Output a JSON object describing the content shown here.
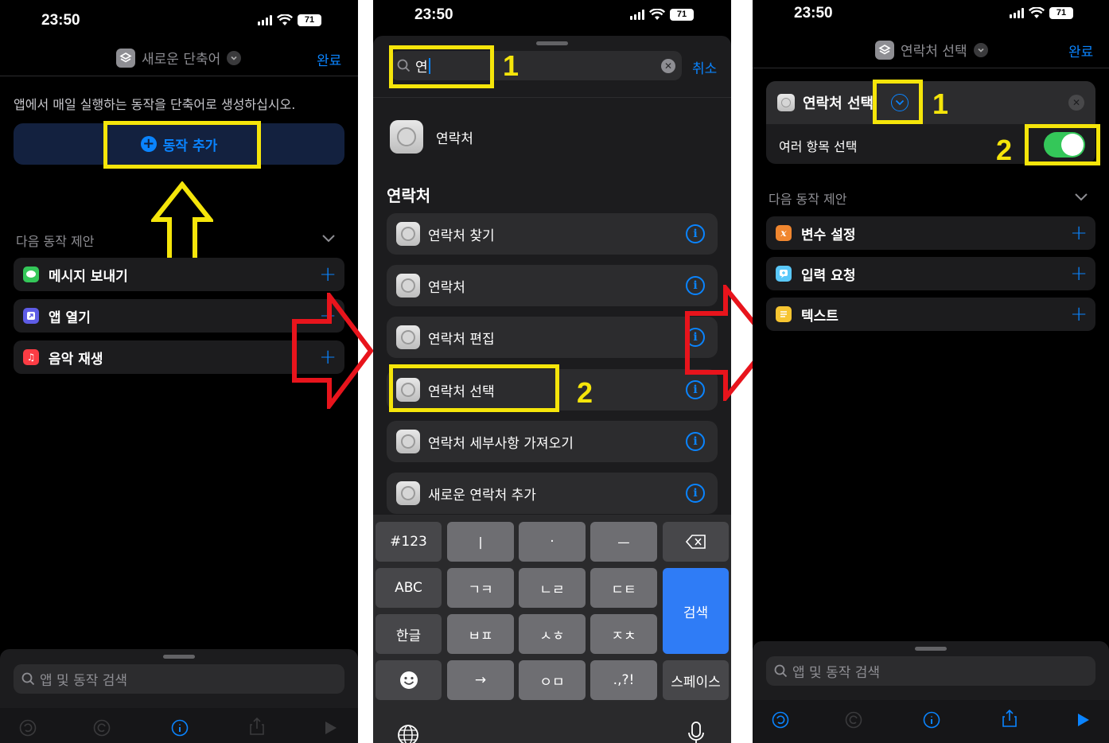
{
  "panel1": {
    "time": "23:50",
    "battery": "71",
    "nav_title": "새로운 단축어",
    "done": "완료",
    "description": "앱에서 매일 실행하는 동작을 단축어로 생성하십시오.",
    "add_action": "동작 추가",
    "suggestions_header": "다음 동작 제안",
    "suggestions": [
      {
        "label": "메시지 보내기",
        "icon": "messages-icon",
        "color": "#34c759"
      },
      {
        "label": "앱 열기",
        "icon": "open-app-icon",
        "color": "#5e5ce6"
      },
      {
        "label": "음악 재생",
        "icon": "music-icon",
        "color": "#fc3c44"
      }
    ],
    "search_placeholder": "앱 및 동작 검색"
  },
  "panel2": {
    "time": "23:50",
    "battery": "71",
    "search_value": "연",
    "cancel": "취소",
    "top_app": "연락처",
    "section_header": "연락처",
    "results": [
      "연락처 찾기",
      "연락처",
      "연락처 편집",
      "연락처 선택",
      "연락처 세부사항 가져오기",
      "새로운 연락처 추가"
    ],
    "annotation_1": "1",
    "annotation_2": "2",
    "keyboard": {
      "row1": [
        "#123",
        "ㅣ",
        "·",
        "ㅡ"
      ],
      "row2": [
        "ABC",
        "ㄱㅋ",
        "ㄴㄹ",
        "ㄷㅌ"
      ],
      "row3": [
        "한글",
        "ㅂㅍ",
        "ㅅㅎ",
        "ㅈㅊ"
      ],
      "row4": [
        "→",
        "ㅇㅁ",
        ".,?!",
        "스페이스"
      ],
      "search_key": "검색"
    }
  },
  "panel3": {
    "time": "23:50",
    "battery": "71",
    "nav_title": "연락처 선택",
    "done": "완료",
    "action_title": "연락처 선택",
    "multi_select_label": "여러 항목 선택",
    "multi_select_on": true,
    "suggestions_header": "다음 동작 제안",
    "suggestions": [
      {
        "label": "변수 설정",
        "icon": "variable-icon",
        "color": "#f0862f"
      },
      {
        "label": "입력 요청",
        "icon": "ask-input-icon",
        "color": "#5ac8fa"
      },
      {
        "label": "텍스트",
        "icon": "text-icon",
        "color": "#f7c531"
      }
    ],
    "search_placeholder": "앱 및 동작 검색",
    "annotation_1": "1",
    "annotation_2": "2"
  },
  "colors": {
    "accent": "#0a84ff",
    "highlight": "#f5e50a",
    "arrow_red": "#e8141c",
    "toggle_on": "#34c759"
  }
}
